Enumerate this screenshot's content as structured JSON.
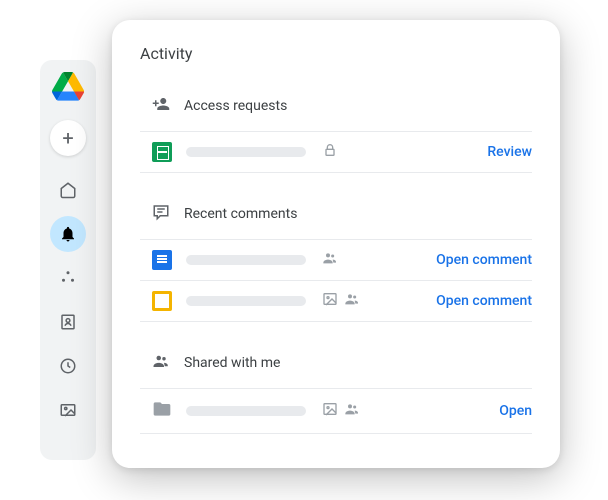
{
  "panel": {
    "title": "Activity"
  },
  "sections": {
    "access": {
      "label": "Access requests",
      "rows": [
        {
          "action": "Review"
        }
      ]
    },
    "comments": {
      "label": "Recent comments",
      "rows": [
        {
          "action": "Open comment"
        },
        {
          "action": "Open comment"
        }
      ]
    },
    "shared": {
      "label": "Shared with me",
      "rows": [
        {
          "action": "Open"
        }
      ]
    }
  },
  "sidebar": {
    "add": "+"
  }
}
